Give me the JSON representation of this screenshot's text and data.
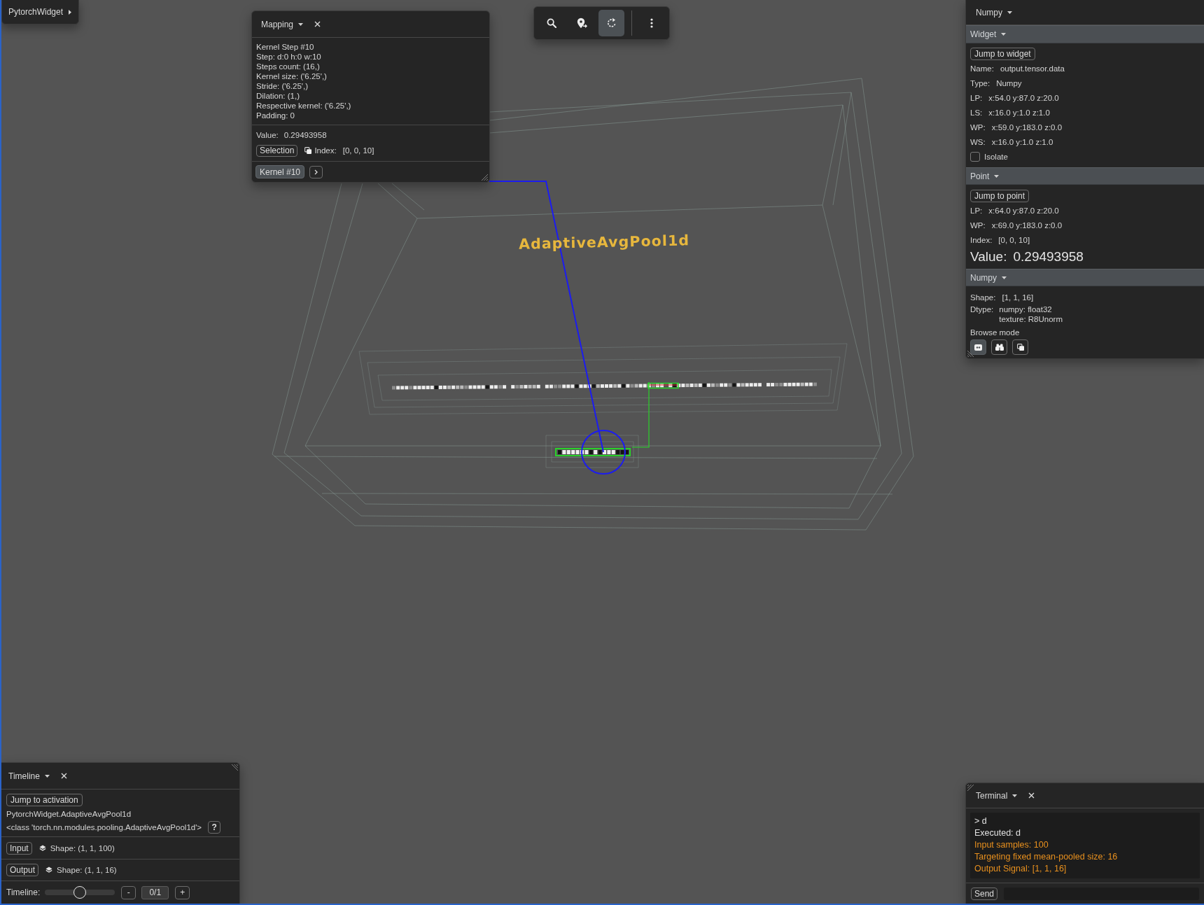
{
  "app_menu": {
    "label": "PytorchWidget"
  },
  "mapping": {
    "title": "Mapping",
    "kernel_info": [
      "Kernel Step #10",
      "Step: d:0 h:0 w:10",
      "Steps count: (16,)",
      "Kernel size: ('6.25',)",
      "Stride: ('6.25',)",
      "Dilation: (1,)",
      "Respective kernel: ('6.25',)",
      "Padding: 0"
    ],
    "value": {
      "label": "Value:",
      "text": "0.29493958"
    },
    "selection_button": "Selection",
    "index": {
      "label": "Index:",
      "text": "[0, 0, 10]"
    },
    "kernel_button": {
      "label": "Kernel #10",
      "selected": true
    }
  },
  "toolbar": {
    "groups": [
      [
        {
          "kind": "search",
          "selected": false
        },
        {
          "kind": "pin",
          "selected": false
        },
        {
          "kind": "rotate",
          "selected": true
        }
      ],
      [
        {
          "kind": "more",
          "selected": false
        }
      ]
    ]
  },
  "scene": {
    "layer_label": "AdaptiveAvgPool1d"
  },
  "inspector": {
    "title": "Numpy",
    "sections": [
      {
        "kind": "widget",
        "title": "Widget",
        "button": "Jump to widget",
        "fields": [
          {
            "label": "Name:",
            "value": "output.tensor.data"
          },
          {
            "label": "Type:",
            "value": "Numpy"
          },
          {
            "label": "LP:",
            "value": "x:54.0 y:87.0 z:20.0"
          },
          {
            "label": "LS:",
            "value": "x:16.0 y:1.0 z:1.0"
          },
          {
            "label": "WP:",
            "value": "x:59.0 y:183.0 z:0.0"
          },
          {
            "label": "WS:",
            "value": "x:16.0 y:1.0 z:1.0"
          }
        ],
        "isolate": {
          "label": "Isolate",
          "checked": false
        }
      },
      {
        "kind": "point",
        "title": "Point",
        "button": "Jump to point",
        "fields": [
          {
            "label": "LP:",
            "value": "x:64.0 y:87.0 z:20.0"
          },
          {
            "label": "WP:",
            "value": "x:69.0 y:183.0 z:0.0"
          },
          {
            "label": "Index:",
            "value": "[0, 0, 10]"
          }
        ],
        "value": {
          "label": "Value:",
          "text": "0.29493958"
        }
      },
      {
        "kind": "numpy",
        "title": "Numpy",
        "fields": [
          {
            "label": "Shape:",
            "value": "[1, 1, 16]"
          },
          {
            "label": "Dtype:",
            "lines": [
              "numpy: float32",
              "texture: R8Unorm"
            ]
          }
        ],
        "browse_label": "Browse mode",
        "browse_modes": [
          {
            "kind": "tile",
            "selected": true
          },
          {
            "kind": "binoculars",
            "selected": false
          },
          {
            "kind": "copy",
            "selected": false
          }
        ]
      }
    ]
  },
  "timeline": {
    "title": "Timeline",
    "jump_button": "Jump to activation",
    "module": "PytorchWidget.AdaptiveAvgPool1d",
    "class_name": "<class 'torch.nn.modules.pooling.AdaptiveAvgPool1d'>",
    "help_button": "?",
    "tensors": [
      {
        "label": "Input",
        "shape": "Shape: (1, 1, 100)"
      },
      {
        "label": "Output",
        "shape": "Shape: (1, 1, 16)"
      }
    ],
    "slider": {
      "label": "Timeline:",
      "level": 0.5
    },
    "step_down": "-",
    "counter": "0/1",
    "step_up": "+"
  },
  "terminal": {
    "title": "Terminal",
    "lines": [
      {
        "kind": "command",
        "text": "> d"
      },
      {
        "kind": "info",
        "text": "Executed: d"
      },
      {
        "kind": "result",
        "text": "Input samples: 100"
      },
      {
        "kind": "result",
        "text": "Targeting fixed mean-pooled size: 16"
      },
      {
        "kind": "result",
        "text": "Output Signal: [1, 1, 16]"
      }
    ],
    "send_button": "Send"
  }
}
